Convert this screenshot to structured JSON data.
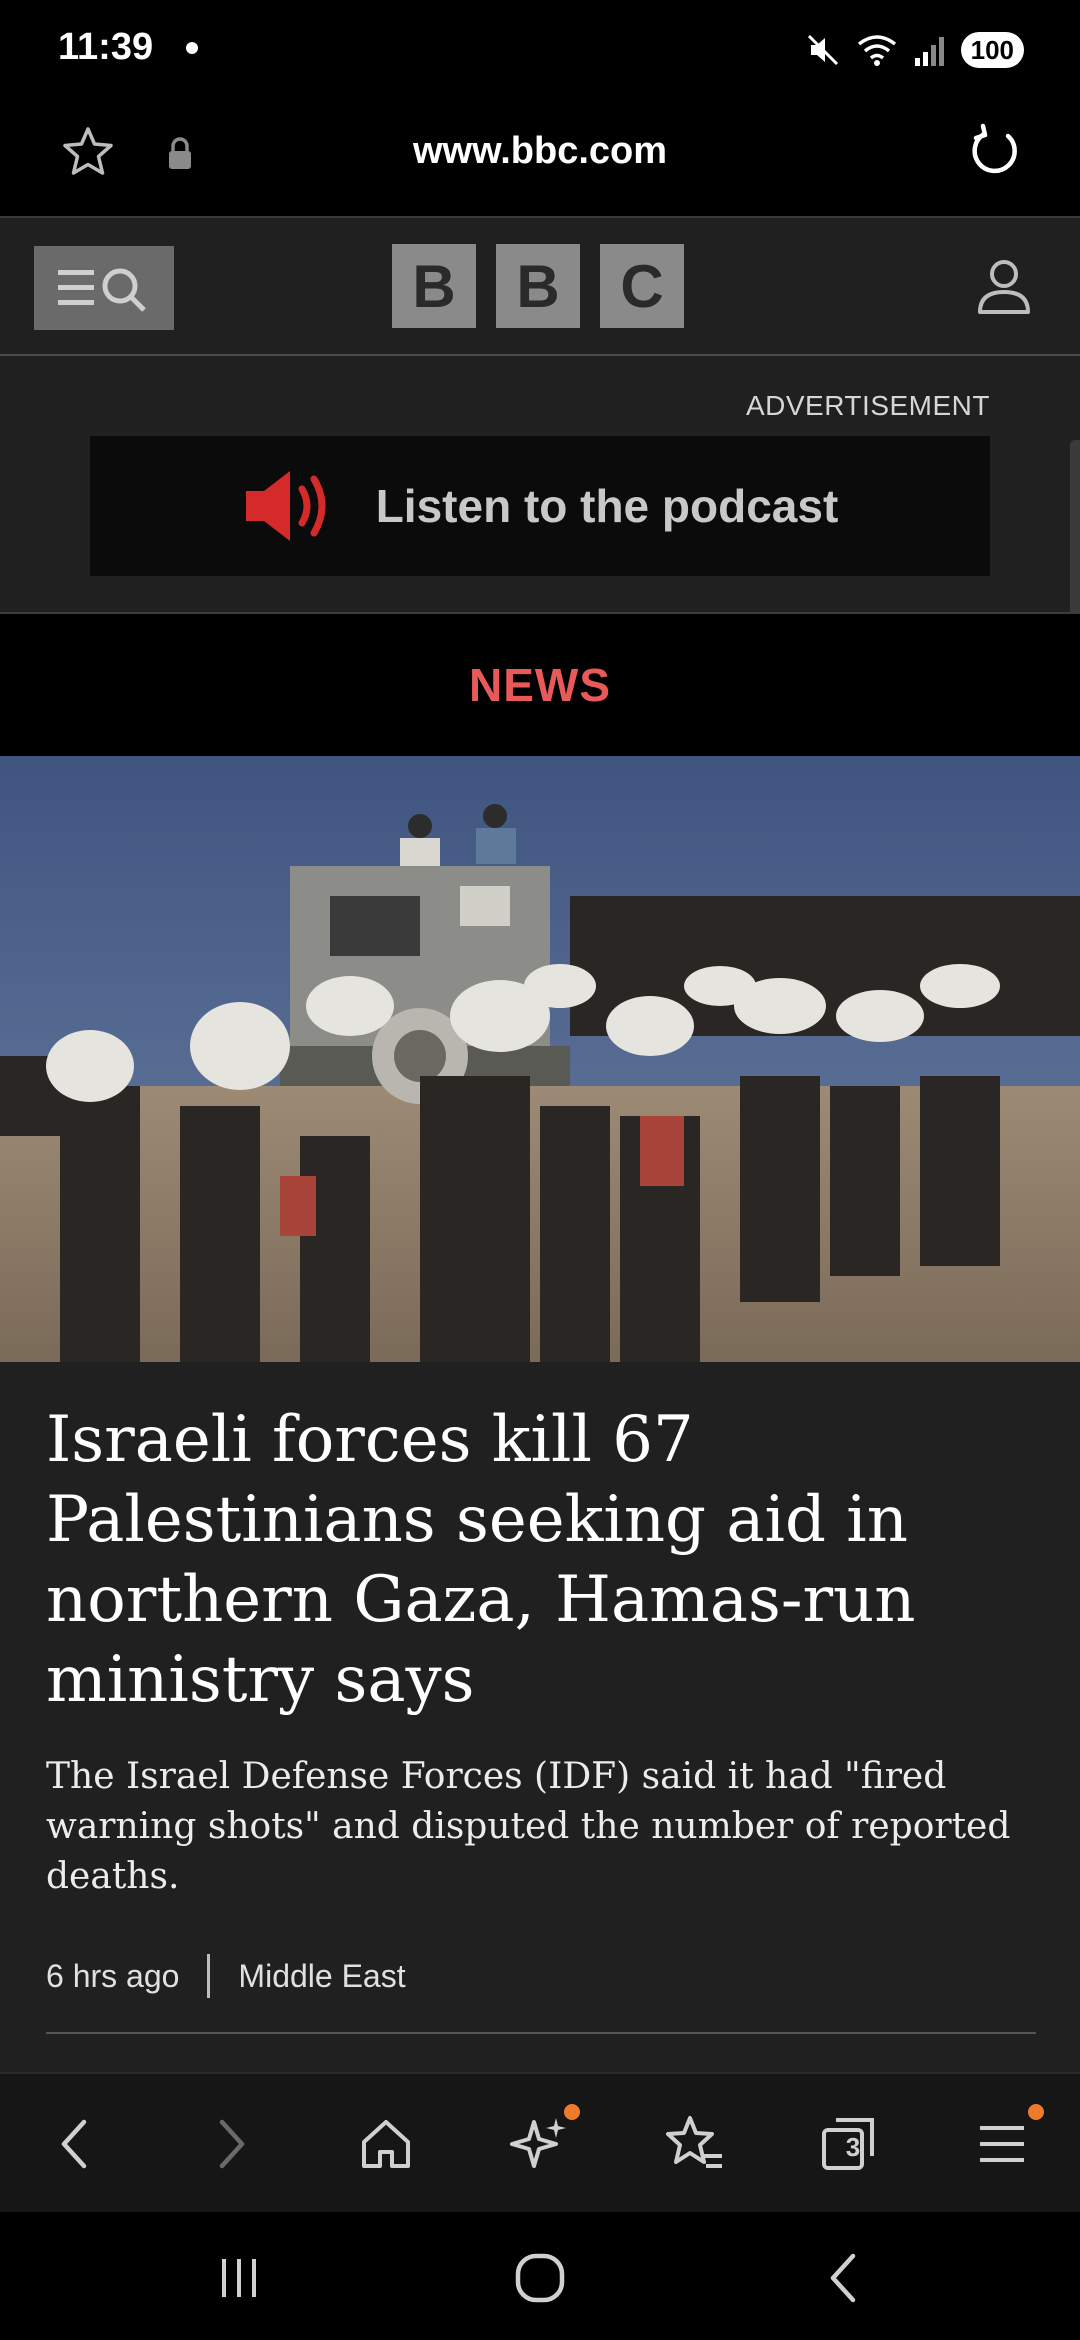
{
  "status_bar": {
    "time": "11:39",
    "battery": "100",
    "icons": [
      "notification-dot",
      "mute-icon",
      "wifi-icon",
      "signal-icon",
      "battery-icon"
    ]
  },
  "browser": {
    "url": "www.bbc.com",
    "tab_count": "3"
  },
  "bbc": {
    "logo_letters": [
      "B",
      "B",
      "C"
    ]
  },
  "ad": {
    "label": "ADVERTISEMENT",
    "banner_text": "Listen to the podcast"
  },
  "section": {
    "label": "NEWS"
  },
  "article": {
    "headline": "Israeli forces kill 67 Palestinians seeking aid in northern Gaza, Hamas-run ministry says",
    "summary": "The Israel Defense Forces (IDF) said it had \"fired warning shots\" and disputed the number of reported deaths.",
    "time_ago": "6 hrs ago",
    "category": "Middle East"
  },
  "colors": {
    "news_accent": "#e85a5a",
    "ad_speaker": "#d42a2a",
    "badge": "#f07a2c"
  }
}
